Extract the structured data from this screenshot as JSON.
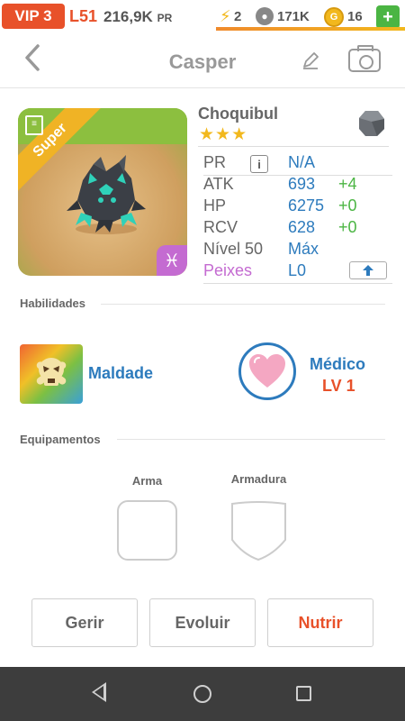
{
  "status_bar": {
    "vip": "VIP 3",
    "level": "L51",
    "power": "216,9K",
    "power_unit": "PR",
    "energy": "2",
    "paw": "171K",
    "coins": "16",
    "add_label": "+"
  },
  "header": {
    "title": "Casper"
  },
  "monster": {
    "name": "Choquibul",
    "stars": "★★★",
    "rarity_ribbon": "Super",
    "element_symbol": "♓",
    "stats": [
      {
        "label": "PR",
        "value": "N/A",
        "bonus": ""
      },
      {
        "label": "ATK",
        "value": "693",
        "bonus": "+4"
      },
      {
        "label": "HP",
        "value": "6275",
        "bonus": "+0"
      },
      {
        "label": "RCV",
        "value": "628",
        "bonus": "+0"
      },
      {
        "label": "Nível 50",
        "value": "Máx",
        "bonus": ""
      },
      {
        "label": "Peixes",
        "value": "L0",
        "bonus": ""
      }
    ]
  },
  "skills": {
    "section_title": "Habilidades",
    "skill_name": "Maldade",
    "leader_name": "Médico",
    "leader_level": "LV 1"
  },
  "equipment": {
    "section_title": "Equipamentos",
    "weapon_label": "Arma",
    "armor_label": "Armadura"
  },
  "actions": {
    "manage": "Gerir",
    "evolve": "Evoluir",
    "feed": "Nutrir"
  },
  "colors": {
    "accent_orange": "#e8512a",
    "stat_blue": "#2d7bbd",
    "bonus_green": "#4bb543",
    "fish_purple": "#c46bd1",
    "gold": "#f2b81d"
  },
  "icons": {
    "back": "chevron-left-icon",
    "edit": "pencil-icon",
    "camera": "camera-icon",
    "info": "info-icon",
    "upgrade": "arrow-up-icon",
    "element": "pisces-icon",
    "type": "rock-icon"
  }
}
